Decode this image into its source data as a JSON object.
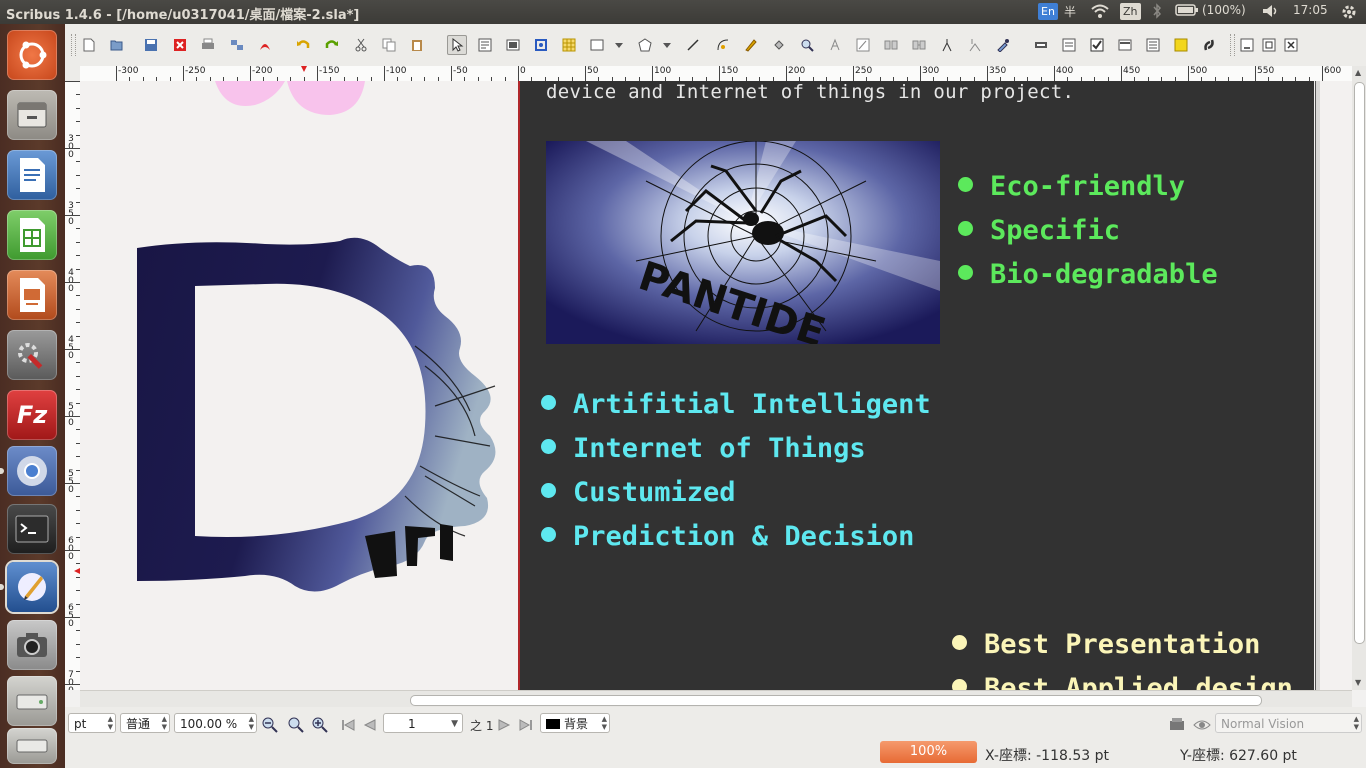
{
  "window": {
    "title": "Scribus 1.4.6 - [/home/u0317041/桌面/檔案-2.sla*]"
  },
  "tray": {
    "ime": "En",
    "ime_half": "半",
    "lang": "Zh",
    "battery": "(100%)",
    "time": "17:05"
  },
  "rulers": {
    "h_labels": [
      "-300",
      "-250",
      "-200",
      "-150",
      "-100",
      "-50",
      "0",
      "50",
      "100",
      "150",
      "200",
      "250",
      "300",
      "350",
      "400",
      "450",
      "500",
      "550",
      "600"
    ],
    "v_labels": [
      "300",
      "350",
      "400",
      "450",
      "500",
      "550",
      "600",
      "650",
      "700"
    ]
  },
  "canvas": {
    "top_text": "device and Internet of things in our project.",
    "logo_text": "PANTIDE",
    "green_list": [
      "Eco-friendly",
      "Specific",
      "Bio-degradable"
    ],
    "cyan_list": [
      "Artifitial Intelligent",
      "Internet of Things",
      "Custumized",
      "Prediction & Decision"
    ],
    "yellow_list": [
      "Best Presentation",
      "Best Applied design"
    ]
  },
  "status": {
    "unit": "pt",
    "mode": "普通",
    "zoom": "100.00 %",
    "page": "1",
    "page_of": "之 1",
    "layer": "背景",
    "vision": "Normal Vision",
    "progress": "100%",
    "x_coord": "X-座標:  -118.53 pt",
    "y_coord": "Y-座標:  627.60 pt"
  },
  "colors": {
    "accent_green": "#5ce95c",
    "accent_cyan": "#5ee8f0",
    "accent_yellow": "#fbf5b8",
    "page_bg": "#323232",
    "page_edge": "#b0272b"
  }
}
